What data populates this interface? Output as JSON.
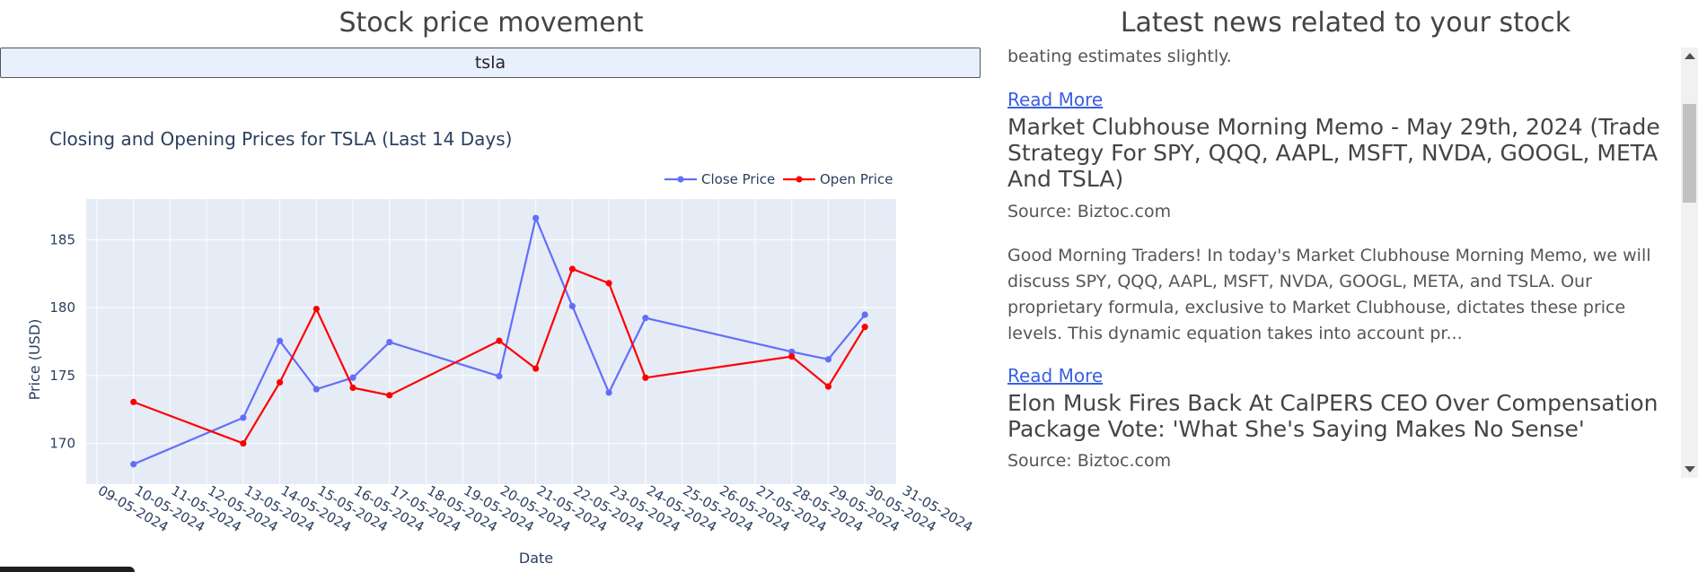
{
  "left": {
    "title": "Stock price movement",
    "ticker_value": "tsla"
  },
  "right": {
    "title": "Latest news related to your stock",
    "top_text": "beating estimates slightly.",
    "read_more_label": "Read More",
    "articles": [
      {
        "headline": "Market Clubhouse Morning Memo - May 29th, 2024 (Trade Strategy For SPY, QQQ, AAPL, MSFT, NVDA, GOOGL, META And TSLA)",
        "source": "Source: Biztoc.com",
        "summary": "Good Morning Traders! In today's Market Clubhouse Morning Memo, we will discuss SPY, QQQ, AAPL, MSFT, NVDA, GOOGL, META, and TSLA. Our proprietary formula, exclusive to Market Clubhouse, dictates these price levels. This dynamic equation takes into account pr..."
      },
      {
        "headline": "Elon Musk Fires Back At CalPERS CEO Over Compensation Package Vote: 'What She's Saying Makes No Sense'",
        "source": "Source: Biztoc.com"
      }
    ]
  },
  "chart_data": {
    "type": "line",
    "title": "Closing and Opening Prices for TSLA (Last 14 Days)",
    "xlabel": "Date",
    "ylabel": "Price (USD)",
    "x_ticks": [
      "09-05-2024",
      "10-05-2024",
      "11-05-2024",
      "12-05-2024",
      "13-05-2024",
      "14-05-2024",
      "15-05-2024",
      "16-05-2024",
      "17-05-2024",
      "18-05-2024",
      "19-05-2024",
      "20-05-2024",
      "21-05-2024",
      "22-05-2024",
      "23-05-2024",
      "24-05-2024",
      "25-05-2024",
      "26-05-2024",
      "27-05-2024",
      "28-05-2024",
      "29-05-2024",
      "30-05-2024",
      "31-05-2024"
    ],
    "y_ticks": [
      170,
      175,
      180,
      185
    ],
    "ylim": [
      167.0,
      188.0
    ],
    "grid": true,
    "legend_position": "top-right",
    "series": [
      {
        "name": "Close Price",
        "color": "#636efa",
        "points": [
          [
            "10-05-2024",
            168.47
          ],
          [
            "13-05-2024",
            171.89
          ],
          [
            "14-05-2024",
            177.55
          ],
          [
            "15-05-2024",
            173.99
          ],
          [
            "16-05-2024",
            174.84
          ],
          [
            "17-05-2024",
            177.46
          ],
          [
            "20-05-2024",
            174.95
          ],
          [
            "21-05-2024",
            186.6
          ],
          [
            "22-05-2024",
            180.11
          ],
          [
            "23-05-2024",
            173.74
          ],
          [
            "24-05-2024",
            179.24
          ],
          [
            "28-05-2024",
            176.75
          ],
          [
            "29-05-2024",
            176.19
          ],
          [
            "30-05-2024",
            179.48
          ]
        ]
      },
      {
        "name": "Open Price",
        "color": "#ff0000",
        "points": [
          [
            "10-05-2024",
            173.05
          ],
          [
            "13-05-2024",
            170.0
          ],
          [
            "14-05-2024",
            174.5
          ],
          [
            "15-05-2024",
            179.9
          ],
          [
            "16-05-2024",
            174.1
          ],
          [
            "17-05-2024",
            173.55
          ],
          [
            "20-05-2024",
            177.56
          ],
          [
            "21-05-2024",
            175.51
          ],
          [
            "22-05-2024",
            182.85
          ],
          [
            "23-05-2024",
            181.8
          ],
          [
            "24-05-2024",
            174.84
          ],
          [
            "28-05-2024",
            176.4
          ],
          [
            "29-05-2024",
            174.19
          ],
          [
            "30-05-2024",
            178.58
          ]
        ]
      }
    ]
  }
}
